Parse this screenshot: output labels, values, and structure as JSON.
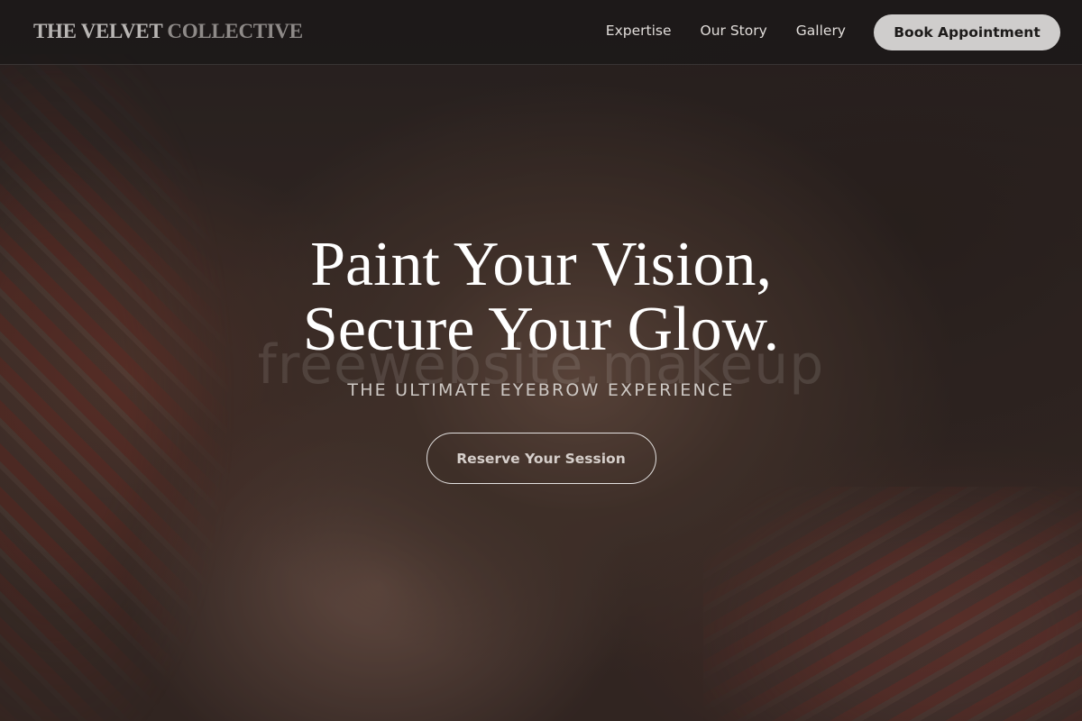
{
  "header": {
    "brand_part1": "THE VELVET",
    "brand_part2": "COLLECTIVE",
    "nav": [
      {
        "label": "Expertise"
      },
      {
        "label": "Our Story"
      },
      {
        "label": "Gallery"
      }
    ],
    "cta_label": "Book Appointment"
  },
  "hero": {
    "headline_line1": "Paint Your Vision,",
    "headline_line2": "Secure Your Glow.",
    "watermark": "freewebsite.makeup",
    "subtitle": "THE ULTIMATE EYEBROW EXPERIENCE",
    "cta_label": "Reserve Your Session"
  },
  "colors": {
    "header_bg": "#1a1818",
    "cta_bg": "#cfcdcc",
    "headline": "#ffffff"
  }
}
